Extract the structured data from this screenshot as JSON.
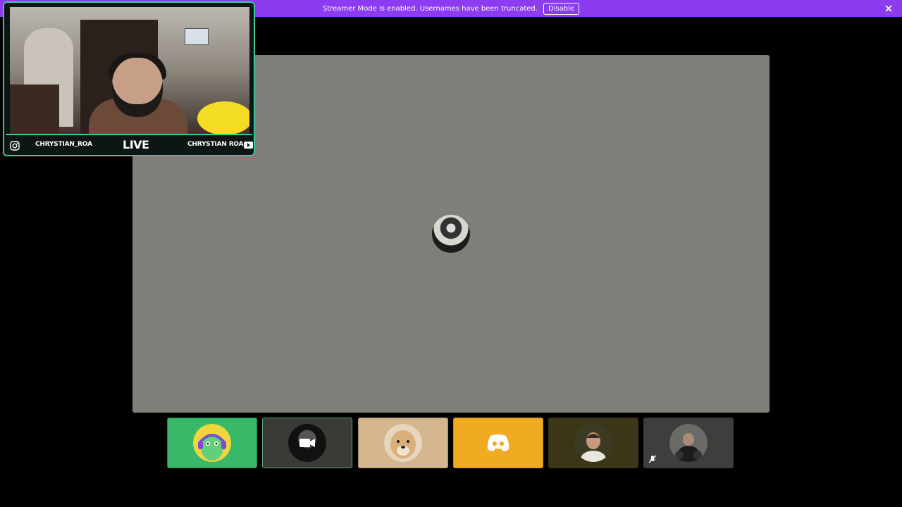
{
  "notice": {
    "message": "Streamer Mode is enabled. Usernames have been truncated.",
    "disable_label": "Disable",
    "close_icon": "close-icon",
    "background": "#8c3cf0"
  },
  "webcam_overlay": {
    "left_username": "CHRYSTIAN_ROA",
    "live_label": "LIVE",
    "right_username": "CHRYSTIAN ROA",
    "left_icon": "instagram-icon",
    "right_icon": "youtube-icon",
    "accent": "#36c9a0"
  },
  "stage": {
    "background": "#7f7f7a",
    "avatar": "participant-avatar"
  },
  "participants": [
    {
      "name": "participant-1",
      "background": "#3ab86a",
      "avatar": "green-headset-avatar"
    },
    {
      "name": "participant-2",
      "background": "#3a3a37",
      "avatar": "camera-icon-avatar"
    },
    {
      "name": "participant-3",
      "background": "#d4b68f",
      "avatar": "dog-avatar"
    },
    {
      "name": "participant-4",
      "background": "#f0ab22",
      "avatar": "discord-logo-avatar"
    },
    {
      "name": "participant-5",
      "background": "#3a3617",
      "avatar": "person-avatar"
    },
    {
      "name": "participant-6",
      "background": "#3e3e3c",
      "avatar": "person-avatar",
      "muted_icon": "mic-muted-icon"
    }
  ]
}
